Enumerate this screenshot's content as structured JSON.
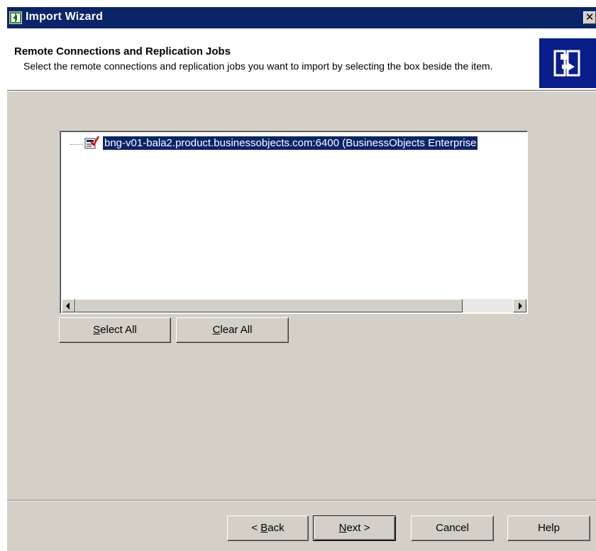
{
  "window": {
    "title": "Import Wizard",
    "close_glyph": "✕",
    "icon": "import-wizard-icon",
    "accent_color": "#0a246a"
  },
  "header": {
    "title": "Remote Connections and Replication Jobs",
    "description": "Select the remote connections and replication jobs you want to import by selecting the box beside the item.",
    "icon": "import-arrow-icon"
  },
  "tree": {
    "items": [
      {
        "label": "bng-v01-bala2.product.businessobjects.com:6400 (BusinessObjects Enterprise",
        "checked": true,
        "selected": true,
        "icon": "checked-connection-icon"
      }
    ]
  },
  "list_buttons": {
    "select_all": {
      "mnemonic": "S",
      "rest": "elect All"
    },
    "clear_all": {
      "mnemonic": "C",
      "rest": "lear All"
    }
  },
  "footer": {
    "back": {
      "prefix": "< ",
      "mnemonic": "B",
      "rest": "ack"
    },
    "next": {
      "mnemonic": "N",
      "rest": "ext >"
    },
    "cancel": "Cancel",
    "help": "Help"
  }
}
